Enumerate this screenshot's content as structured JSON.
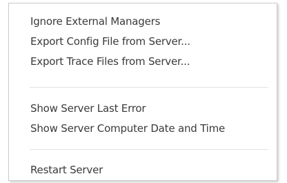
{
  "menu": {
    "items": [
      {
        "label": "Ignore External Managers"
      },
      {
        "label": "Export Config File from Server..."
      },
      {
        "label": "Export Trace Files from Server..."
      },
      {
        "label": "Show Server Last Error"
      },
      {
        "label": "Show Server Computer Date and Time"
      },
      {
        "label": "Restart Server"
      }
    ]
  }
}
